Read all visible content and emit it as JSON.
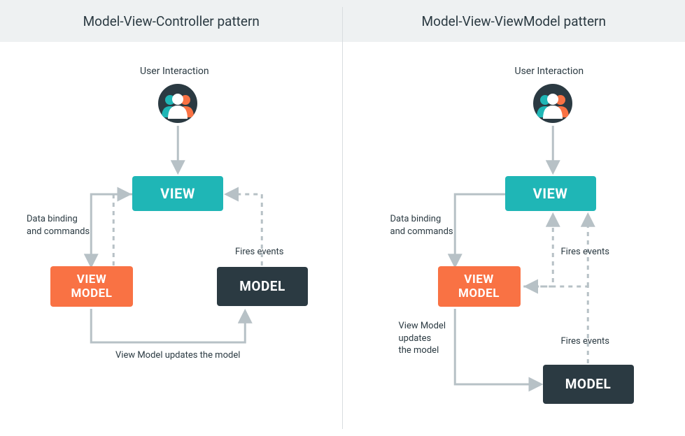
{
  "left": {
    "title": "Model-View-Controller pattern",
    "userInteraction": "User Interaction",
    "view": "VIEW",
    "viewModel": "VIEW\nMODEL",
    "model": "MODEL",
    "dataBinding": "Data binding\nand commands",
    "firesEvents": "Fires events",
    "vmUpdates": "View Model updates the model"
  },
  "right": {
    "title": "Model-View-ViewModel pattern",
    "userInteraction": "User Interaction",
    "view": "VIEW",
    "viewModel": "VIEW\nMODEL",
    "model": "MODEL",
    "dataBinding": "Data binding\nand commands",
    "firesEvents1": "Fires events",
    "firesEvents2": "Fires events",
    "vmUpdates": "View Model\nupdates\nthe model"
  },
  "colors": {
    "teal": "#1fb6b6",
    "orange": "#f97244",
    "dark": "#2b3a42",
    "edge": "#b7c1c6",
    "headerBg": "#eef1f2"
  }
}
